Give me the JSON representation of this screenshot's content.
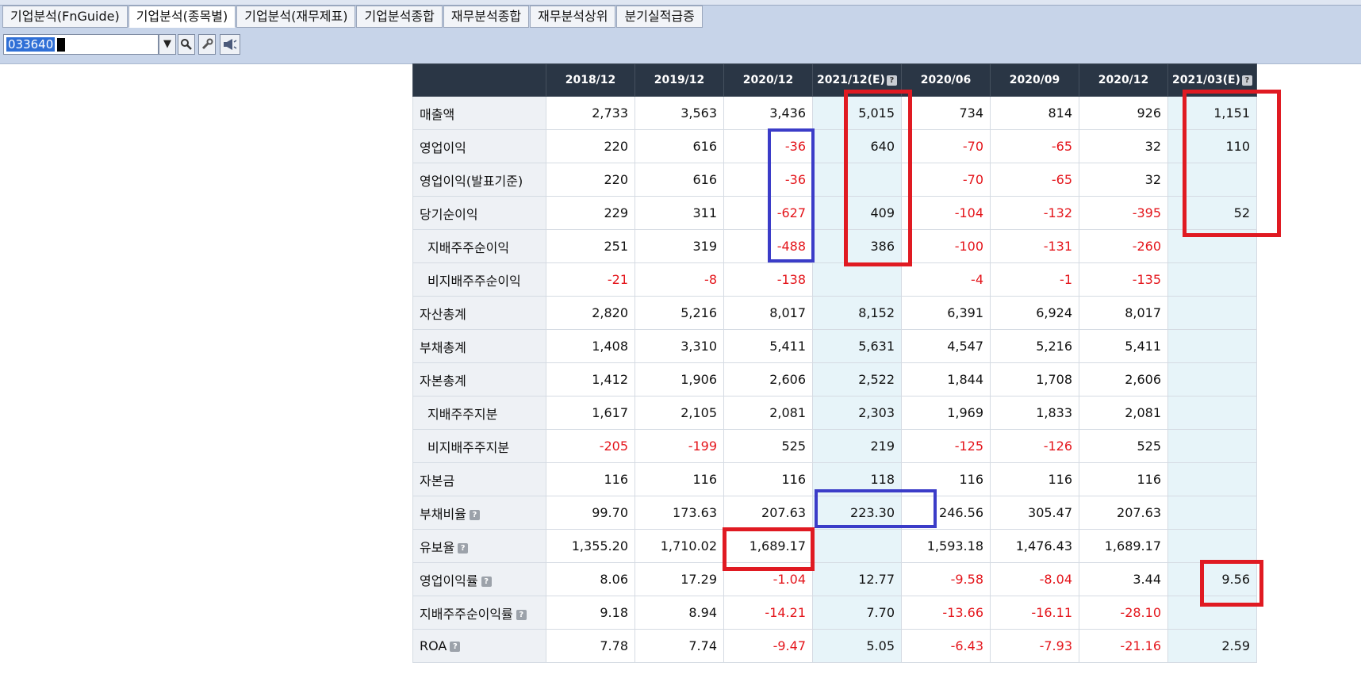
{
  "tabs": [
    {
      "label": "기업분석(FnGuide)"
    },
    {
      "label": "기업분석(종목별)"
    },
    {
      "label": "기업분석(재무제표)"
    },
    {
      "label": "기업분석종합"
    },
    {
      "label": "재무분석종합"
    },
    {
      "label": "재무분석상위"
    },
    {
      "label": "분기실적급증"
    }
  ],
  "code_input": {
    "value": "033640"
  },
  "icons": {
    "dropdown": "chevron-down-icon",
    "search": "magnifier-icon",
    "settings": "wrench-icon",
    "notify": "speaker-icon"
  },
  "table": {
    "columns": [
      "2018/12",
      "2019/12",
      "2020/12",
      "2021/12(E)",
      "2020/06",
      "2020/09",
      "2020/12",
      "2021/03(E)"
    ],
    "help_glyph": "?",
    "rows": [
      {
        "label": "매출액",
        "values": [
          "2,733",
          "3,563",
          "3,436",
          "5,015",
          "734",
          "814",
          "926",
          "1,151"
        ]
      },
      {
        "label": "영업이익",
        "values": [
          "220",
          "616",
          "-36",
          "640",
          "-70",
          "-65",
          "32",
          "110"
        ]
      },
      {
        "label": "영업이익(발표기준)",
        "values": [
          "220",
          "616",
          "-36",
          "",
          "-70",
          "-65",
          "32",
          ""
        ]
      },
      {
        "label": "당기순이익",
        "values": [
          "229",
          "311",
          "-627",
          "409",
          "-104",
          "-132",
          "-395",
          "52"
        ]
      },
      {
        "label": "지배주주순이익",
        "values": [
          "251",
          "319",
          "-488",
          "386",
          "-100",
          "-131",
          "-260",
          ""
        ]
      },
      {
        "label": "비지배주주순이익",
        "values": [
          "-21",
          "-8",
          "-138",
          "",
          "-4",
          "-1",
          "-135",
          ""
        ]
      },
      {
        "label": "자산총계",
        "values": [
          "2,820",
          "5,216",
          "8,017",
          "8,152",
          "6,391",
          "6,924",
          "8,017",
          ""
        ]
      },
      {
        "label": "부채총계",
        "values": [
          "1,408",
          "3,310",
          "5,411",
          "5,631",
          "4,547",
          "5,216",
          "5,411",
          ""
        ]
      },
      {
        "label": "자본총계",
        "values": [
          "1,412",
          "1,906",
          "2,606",
          "2,522",
          "1,844",
          "1,708",
          "2,606",
          ""
        ]
      },
      {
        "label": "지배주주지분",
        "values": [
          "1,617",
          "2,105",
          "2,081",
          "2,303",
          "1,969",
          "1,833",
          "2,081",
          ""
        ]
      },
      {
        "label": "비지배주주지분",
        "values": [
          "-205",
          "-199",
          "525",
          "219",
          "-125",
          "-126",
          "525",
          ""
        ]
      },
      {
        "label": "자본금",
        "values": [
          "116",
          "116",
          "116",
          "118",
          "116",
          "116",
          "116",
          ""
        ]
      },
      {
        "label": "부채비율",
        "values": [
          "99.70",
          "173.63",
          "207.63",
          "223.30",
          "246.56",
          "305.47",
          "207.63",
          ""
        ]
      },
      {
        "label": "유보율",
        "values": [
          "1,355.20",
          "1,710.02",
          "1,689.17",
          "",
          "1,593.18",
          "1,476.43",
          "1,689.17",
          ""
        ]
      },
      {
        "label": "영업이익률",
        "values": [
          "8.06",
          "17.29",
          "-1.04",
          "12.77",
          "-9.58",
          "-8.04",
          "3.44",
          "9.56"
        ]
      },
      {
        "label": "지배주주순이익률",
        "values": [
          "9.18",
          "8.94",
          "-14.21",
          "7.70",
          "-13.66",
          "-16.11",
          "-28.10",
          ""
        ]
      },
      {
        "label": "ROA",
        "values": [
          "7.78",
          "7.74",
          "-9.47",
          "5.05",
          "-6.43",
          "-7.93",
          "-21.16",
          "2.59"
        ]
      }
    ]
  },
  "colors": {
    "negative": "#e4151b",
    "header_bg": "#2a3645",
    "estimate_bg": "#e7f4f9",
    "highlight_red": "#e01a22",
    "highlight_blue": "#3b3cc8"
  }
}
